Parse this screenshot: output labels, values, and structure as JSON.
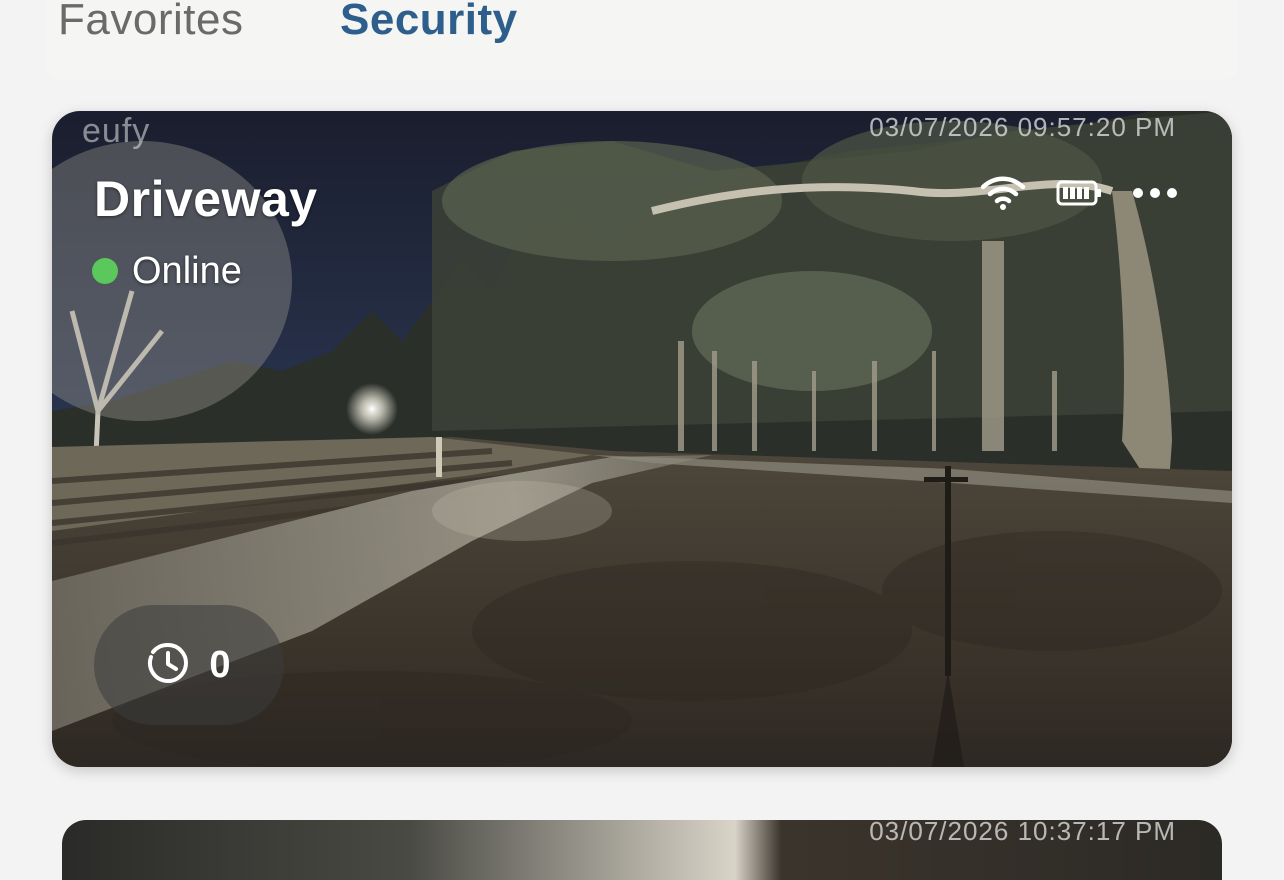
{
  "tabs": {
    "favorites_label": "Favorites",
    "security_label": "Security",
    "active": "Security",
    "active_color": "#2e5f8c"
  },
  "cameras": [
    {
      "watermark": "eufy",
      "timestamp": "03/07/2026  09:57:20  PM",
      "name": "Driveway",
      "status": "Online",
      "status_color": "#5ac85a",
      "event_count": "0",
      "icons": [
        "wifi-icon",
        "battery-icon",
        "more-options-icon",
        "history-icon"
      ]
    },
    {
      "timestamp": "03/07/2026  10:37:17  PM"
    }
  ]
}
